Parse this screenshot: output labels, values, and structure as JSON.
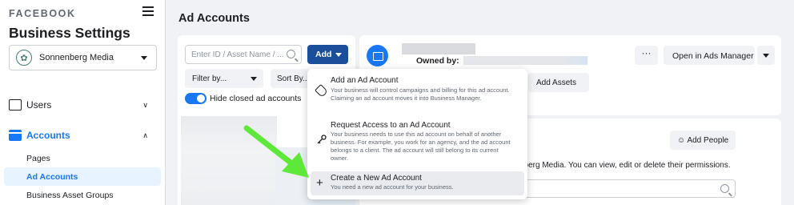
{
  "sidebar": {
    "brand": "FACEBOOK",
    "title": "Business Settings",
    "business_name": "Sonnenberg Media",
    "nav": {
      "users": "Users",
      "accounts": "Accounts"
    },
    "sub_items": [
      "Pages",
      "Ad Accounts",
      "Business Asset Groups"
    ]
  },
  "main": {
    "page_title": "Ad Accounts",
    "search_placeholder": "Enter ID / Asset Name / ...",
    "add_label": "Add",
    "filter_label": "Filter by...",
    "sort_label": "Sort By...",
    "toggle_label": "Hide closed ad accounts",
    "owned_label": "Owned by:",
    "more_label": "···",
    "open_ads_manager": "Open in Ads Manager",
    "add_assets": "Add Assets",
    "add_people": "Add People",
    "permissions_text": "nberg Media. You can view, edit or delete their permissions."
  },
  "dropdown": {
    "items": [
      {
        "title": "Add an Ad Account",
        "desc": "Your business will control campaigns and billing for this ad account. Claiming an ad account moves it into Business Manager."
      },
      {
        "title": "Request Access to an Ad Account",
        "desc": "Your business needs to use this ad account on behalf of another business. For example, you work for an agency, and the ad account belongs to a client. The ad account will still belong to its current owner."
      },
      {
        "title": "Create a New Ad Account",
        "desc": "You need a new ad account for your business."
      }
    ]
  },
  "colors": {
    "accent": "#1877f2",
    "add_button": "#1b4f9c",
    "annotation_arrow": "#5ee83a"
  }
}
